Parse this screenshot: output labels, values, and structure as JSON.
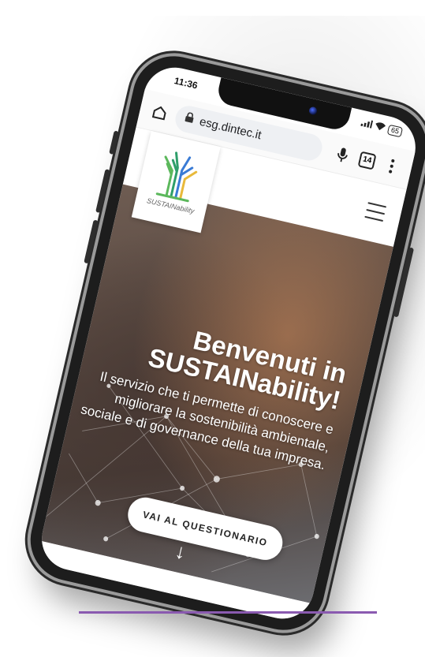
{
  "status_bar": {
    "time": "11:36",
    "battery": "65"
  },
  "browser": {
    "url": "esg.dintec.it",
    "tab_count": "14"
  },
  "site": {
    "logo_text": "SUSTAINability",
    "hero_title_line1": "Benvenuti in",
    "hero_title_line2": "SUSTAINability!",
    "hero_subtitle": "Il servizio che ti permette di conoscere e migliorare la sostenibilità ambientale, sociale e di governance della tua impresa.",
    "cta_label": "VAI AL QUESTIONARIO",
    "scroll_arrow": "↓"
  },
  "colors": {
    "divider": "#8a5ab0",
    "logo_green": "#5cb85c",
    "logo_blue": "#3a7bd5",
    "logo_yellow": "#e8b93a"
  },
  "icons": [
    "home-icon",
    "lock-icon",
    "mic-icon",
    "tabs-icon",
    "more-icon",
    "hamburger-icon",
    "arrow-down-icon",
    "signal-icon",
    "wifi-icon",
    "battery-icon",
    "camera-icon"
  ]
}
